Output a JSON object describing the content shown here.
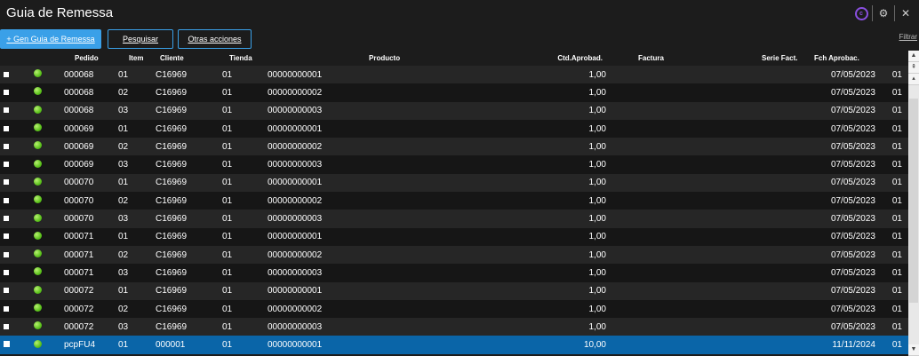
{
  "app": {
    "title": "Guia de Remessa"
  },
  "colors": {
    "accent": "#3aa0e8",
    "status_green": "#5cc21c",
    "selected_row": "#0a65a8"
  },
  "icons": {
    "c_badge": "c-circle-icon",
    "gear": "gear-icon",
    "close": "close-icon"
  },
  "toolbar": {
    "gen_label": "+ Gen Guia de Remessa",
    "pesquisar_label": "Pesquisar",
    "otras_label": "Otras acciones",
    "filtrar_label": "Filtrar"
  },
  "grid": {
    "columns": [
      "Pedido",
      "Item",
      "Cliente",
      "Tienda",
      "Producto",
      "Ctd.Aprobad.",
      "Factura",
      "Serie Fact.",
      "Fch Aprobac."
    ],
    "rows": [
      {
        "pedido": "000068",
        "item": "01",
        "cliente": "C16969",
        "tienda": "01",
        "producto": "00000000001",
        "ctd": "1,00",
        "factura": "",
        "serie": "",
        "fch": "07/05/2023",
        "last": "01"
      },
      {
        "pedido": "000068",
        "item": "02",
        "cliente": "C16969",
        "tienda": "01",
        "producto": "00000000002",
        "ctd": "1,00",
        "factura": "",
        "serie": "",
        "fch": "07/05/2023",
        "last": "01"
      },
      {
        "pedido": "000068",
        "item": "03",
        "cliente": "C16969",
        "tienda": "01",
        "producto": "00000000003",
        "ctd": "1,00",
        "factura": "",
        "serie": "",
        "fch": "07/05/2023",
        "last": "01"
      },
      {
        "pedido": "000069",
        "item": "01",
        "cliente": "C16969",
        "tienda": "01",
        "producto": "00000000001",
        "ctd": "1,00",
        "factura": "",
        "serie": "",
        "fch": "07/05/2023",
        "last": "01"
      },
      {
        "pedido": "000069",
        "item": "02",
        "cliente": "C16969",
        "tienda": "01",
        "producto": "00000000002",
        "ctd": "1,00",
        "factura": "",
        "serie": "",
        "fch": "07/05/2023",
        "last": "01"
      },
      {
        "pedido": "000069",
        "item": "03",
        "cliente": "C16969",
        "tienda": "01",
        "producto": "00000000003",
        "ctd": "1,00",
        "factura": "",
        "serie": "",
        "fch": "07/05/2023",
        "last": "01"
      },
      {
        "pedido": "000070",
        "item": "01",
        "cliente": "C16969",
        "tienda": "01",
        "producto": "00000000001",
        "ctd": "1,00",
        "factura": "",
        "serie": "",
        "fch": "07/05/2023",
        "last": "01"
      },
      {
        "pedido": "000070",
        "item": "02",
        "cliente": "C16969",
        "tienda": "01",
        "producto": "00000000002",
        "ctd": "1,00",
        "factura": "",
        "serie": "",
        "fch": "07/05/2023",
        "last": "01"
      },
      {
        "pedido": "000070",
        "item": "03",
        "cliente": "C16969",
        "tienda": "01",
        "producto": "00000000003",
        "ctd": "1,00",
        "factura": "",
        "serie": "",
        "fch": "07/05/2023",
        "last": "01"
      },
      {
        "pedido": "000071",
        "item": "01",
        "cliente": "C16969",
        "tienda": "01",
        "producto": "00000000001",
        "ctd": "1,00",
        "factura": "",
        "serie": "",
        "fch": "07/05/2023",
        "last": "01"
      },
      {
        "pedido": "000071",
        "item": "02",
        "cliente": "C16969",
        "tienda": "01",
        "producto": "00000000002",
        "ctd": "1,00",
        "factura": "",
        "serie": "",
        "fch": "07/05/2023",
        "last": "01"
      },
      {
        "pedido": "000071",
        "item": "03",
        "cliente": "C16969",
        "tienda": "01",
        "producto": "00000000003",
        "ctd": "1,00",
        "factura": "",
        "serie": "",
        "fch": "07/05/2023",
        "last": "01"
      },
      {
        "pedido": "000072",
        "item": "01",
        "cliente": "C16969",
        "tienda": "01",
        "producto": "00000000001",
        "ctd": "1,00",
        "factura": "",
        "serie": "",
        "fch": "07/05/2023",
        "last": "01"
      },
      {
        "pedido": "000072",
        "item": "02",
        "cliente": "C16969",
        "tienda": "01",
        "producto": "00000000002",
        "ctd": "1,00",
        "factura": "",
        "serie": "",
        "fch": "07/05/2023",
        "last": "01"
      },
      {
        "pedido": "000072",
        "item": "03",
        "cliente": "C16969",
        "tienda": "01",
        "producto": "00000000003",
        "ctd": "1,00",
        "factura": "",
        "serie": "",
        "fch": "07/05/2023",
        "last": "01"
      },
      {
        "pedido": "pcpFU4",
        "item": "01",
        "cliente": "000001",
        "tienda": "01",
        "producto": "00000000001",
        "ctd": "10,00",
        "factura": "",
        "serie": "",
        "fch": "11/11/2024",
        "last": "01",
        "selected": true
      }
    ]
  }
}
